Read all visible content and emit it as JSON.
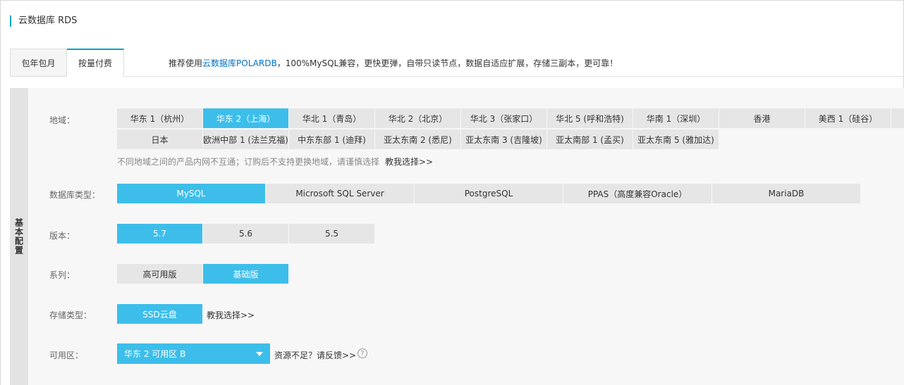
{
  "page": {
    "title": "云数据库 RDS"
  },
  "tabs": [
    {
      "label": "包年包月",
      "active": false
    },
    {
      "label": "按量付费",
      "active": true
    }
  ],
  "promo": {
    "prefix": "推荐使用",
    "link": "云数据库POLARDB",
    "suffix": "，100%MySQL兼容，更快更弹，自带只读节点，数据自适应扩展，存储三副本，更可靠！"
  },
  "section": {
    "title": "基本配置"
  },
  "region": {
    "label": "地域：",
    "selected": "华东 2（上海）",
    "row1": [
      "华东 1（杭州）",
      "华东 2（上海）",
      "华北 1（青岛）",
      "华北 2（北京）",
      "华北 3（张家口）",
      "华北 5 (呼和浩特)",
      "华南 1（深圳）",
      "香港",
      "美西 1（硅谷）"
    ],
    "row2": [
      "日本",
      "欧洲中部 1 (法兰克福)",
      "中东东部 1 (迪拜)",
      "亚太东南 2 (悉尼)",
      "亚太东南 3 (吉隆坡)",
      "亚太南部 1 (孟买)",
      "亚太东南 5 (雅加达)"
    ],
    "note": "不同地域之间的产品内网不互通；订购后不支持更换地域，请谨慎选择",
    "help": "教我选择>>"
  },
  "db_type": {
    "label": "数据库类型：",
    "selected": "MySQL",
    "options": [
      "MySQL",
      "Microsoft SQL Server",
      "PostgreSQL",
      "PPAS（高度兼容Oracle）",
      "MariaDB"
    ]
  },
  "version": {
    "label": "版本：",
    "selected": "5.7",
    "options": [
      "5.7",
      "5.6",
      "5.5"
    ]
  },
  "series": {
    "label": "系列：",
    "selected": "基础版",
    "options": [
      "高可用版",
      "基础版"
    ]
  },
  "storage": {
    "label": "存储类型：",
    "selected": "SSD云盘",
    "options": [
      "SSD云盘"
    ],
    "help": "教我选择>>"
  },
  "zone": {
    "label": "可用区：",
    "value": "华东 2 可用区 B",
    "help": "资源不足？请反馈>>",
    "help_icon": "question-circle-icon"
  },
  "colors": {
    "accent": "#3dbeea",
    "link": "#0070cc",
    "tab_accent": "#00a2ca"
  }
}
